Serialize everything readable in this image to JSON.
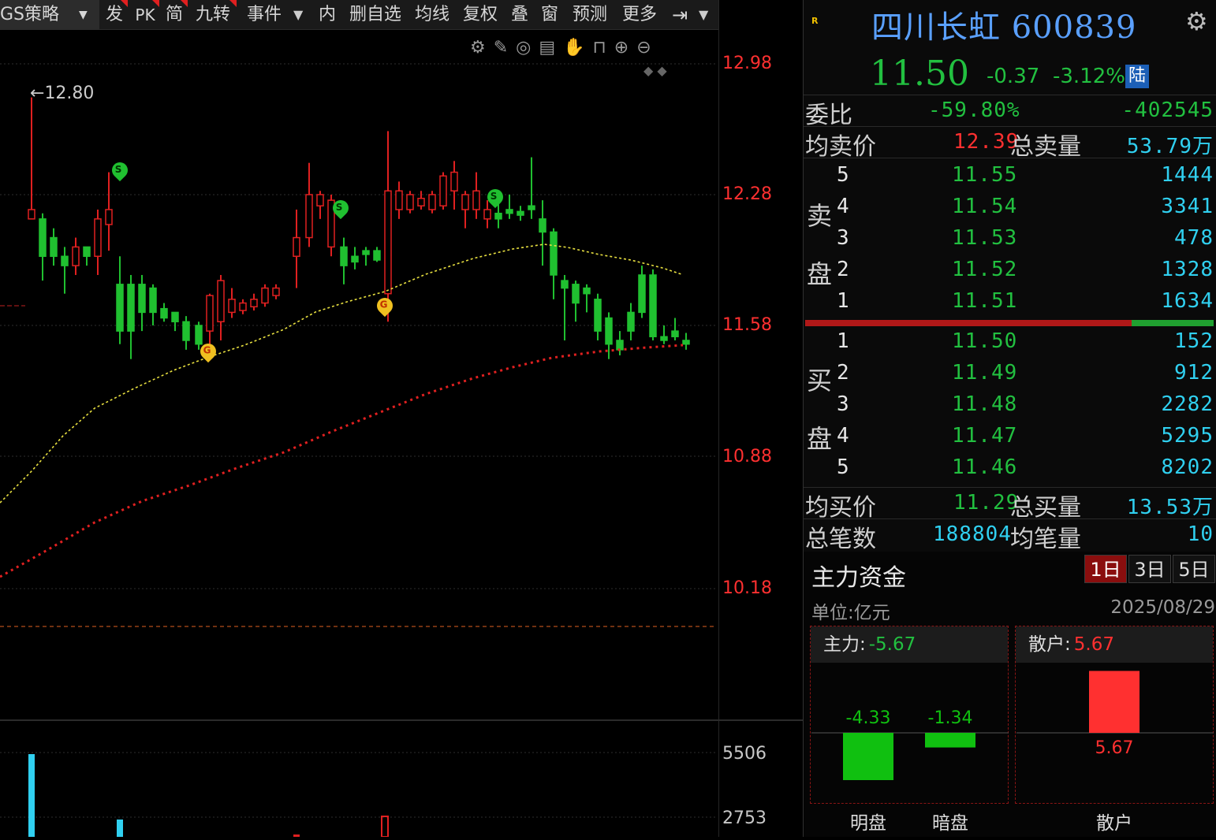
{
  "toolbar": {
    "strategy": "GS策略",
    "items": [
      "发",
      "PK",
      "简",
      "九转",
      "事件",
      "内",
      "删自选",
      "均线",
      "复权",
      "叠",
      "窗",
      "预测",
      "更多"
    ]
  },
  "chart": {
    "price_axis": [
      "12.98",
      "12.28",
      "11.58",
      "10.88",
      "10.18"
    ],
    "high_marker": "12.80",
    "volume_axis": [
      "5506",
      "2753"
    ],
    "signals": {
      "sell": "S",
      "buy": "G"
    }
  },
  "quote": {
    "name": "四川长虹",
    "code": "600839",
    "price": "11.50",
    "change": "-0.37",
    "change_pct": "-3.12%",
    "exchange": "陆",
    "weibi_label": "委比",
    "weibi_pct": "-59.80%",
    "weibi_diff": "-402545",
    "avg_sell_label": "均卖价",
    "avg_sell": "12.39",
    "total_sell_label": "总卖量",
    "total_sell": "53.79万",
    "sell_side": [
      "卖",
      "盘"
    ],
    "buy_side": [
      "买",
      "盘"
    ],
    "asks": [
      {
        "level": "5",
        "price": "11.55",
        "vol": "1444"
      },
      {
        "level": "4",
        "price": "11.54",
        "vol": "3341"
      },
      {
        "level": "3",
        "price": "11.53",
        "vol": "478"
      },
      {
        "level": "2",
        "price": "11.52",
        "vol": "1328"
      },
      {
        "level": "1",
        "price": "11.51",
        "vol": "1634"
      }
    ],
    "bids": [
      {
        "level": "1",
        "price": "11.50",
        "vol": "152"
      },
      {
        "level": "2",
        "price": "11.49",
        "vol": "912"
      },
      {
        "level": "3",
        "price": "11.48",
        "vol": "2282"
      },
      {
        "level": "4",
        "price": "11.47",
        "vol": "5295"
      },
      {
        "level": "5",
        "price": "11.46",
        "vol": "8202"
      }
    ],
    "avg_buy_label": "均买价",
    "avg_buy": "11.29",
    "total_buy_label": "总买量",
    "total_buy": "13.53万",
    "trades_label": "总笔数",
    "trades": "188804",
    "avg_trade_label": "均笔量",
    "avg_trade": "10"
  },
  "capital": {
    "title": "主力资金",
    "tabs": [
      "1日",
      "3日",
      "5日"
    ],
    "active_tab": "1日",
    "unit": "单位:亿元",
    "date": "2025/08/29",
    "main_label": "主力:",
    "main_value": "-5.67",
    "retail_label": "散户:",
    "retail_value": "5.67",
    "bars": [
      {
        "name": "明盘",
        "value": -4.33,
        "label": "-4.33"
      },
      {
        "name": "暗盘",
        "value": -1.34,
        "label": "-1.34"
      },
      {
        "name": "散户",
        "value": 5.67,
        "label": "5.67"
      }
    ],
    "colors": {
      "up": "#ff3030",
      "down": "#10c010"
    }
  }
}
